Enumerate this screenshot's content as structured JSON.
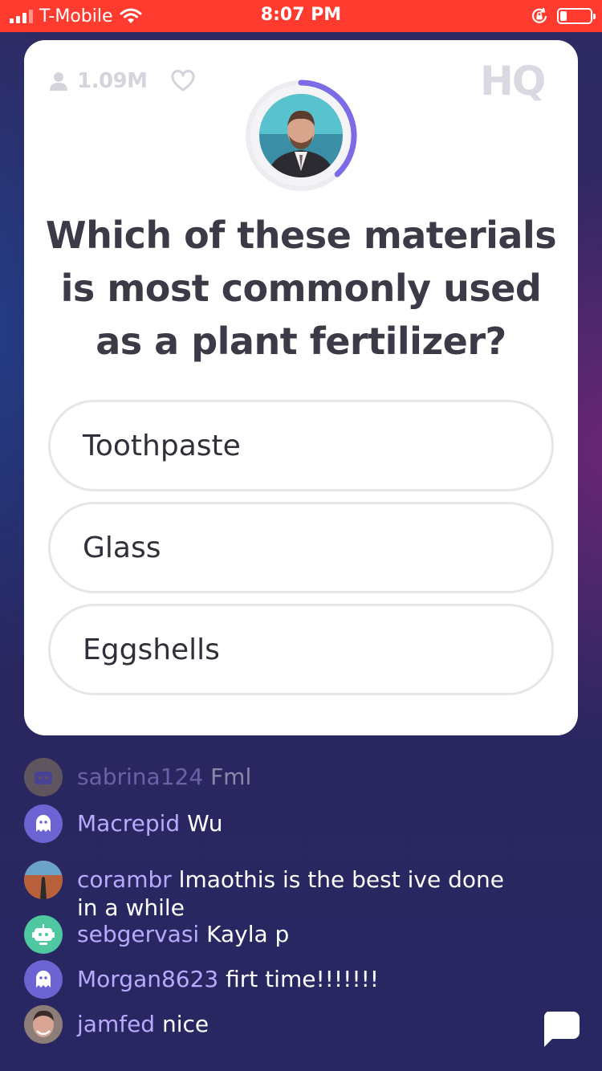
{
  "status": {
    "carrier": "T-Mobile",
    "time": "8:07 PM",
    "battery_level": 0.2
  },
  "game": {
    "viewer_count": "1.09M",
    "logo": "HQ",
    "timer_fraction": 0.38,
    "question": "Which of these materials is most commonly used as a plant fertilizer?",
    "answers": [
      "Toothpaste",
      "Glass",
      "Eggshells"
    ]
  },
  "chat": {
    "messages": [
      {
        "user": "sabrina124",
        "text": "Fml",
        "avatar": "robot-icon"
      },
      {
        "user": "Macrepid",
        "text": "Wu",
        "avatar": "ghost-icon"
      },
      {
        "user": "corambr",
        "text": "lmaothis is the best ive done in a while",
        "avatar": "photo"
      },
      {
        "user": "sebgervasi",
        "text": "Kayla p",
        "avatar": "robot-icon"
      },
      {
        "user": "Morgan8623",
        "text": "firt time!!!!!!!",
        "avatar": "ghost-icon"
      },
      {
        "user": "jamfed",
        "text": "nice",
        "avatar": "photo"
      }
    ]
  },
  "colors": {
    "status_bar": "#ff3b30",
    "timer_arc": "#7b6be4",
    "chat_username": "#b9a9ff",
    "ghost_avatar_bg": "#6d64d4",
    "robot_avatar_bg": "#4fc7a0"
  }
}
